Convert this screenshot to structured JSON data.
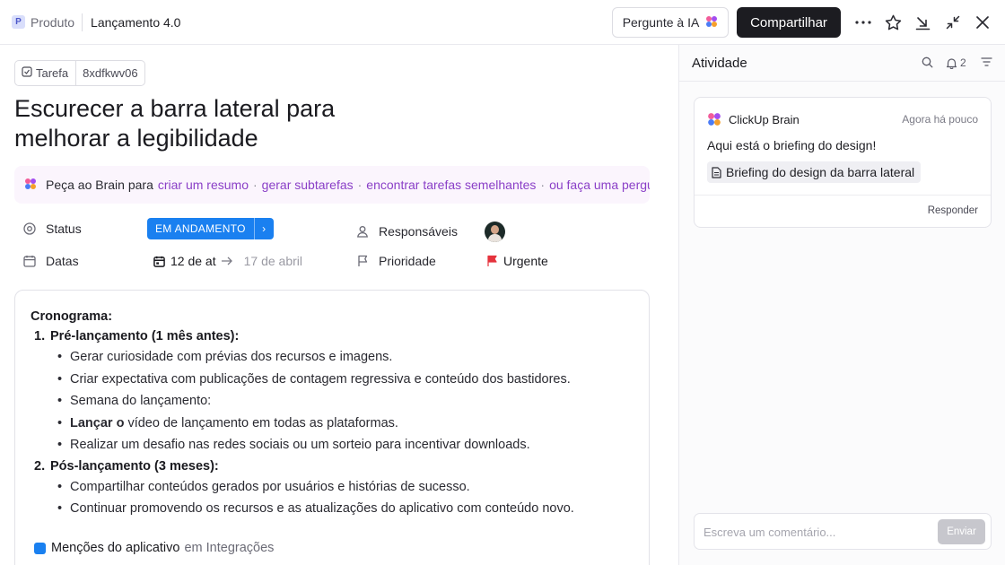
{
  "breadcrumb": {
    "space_badge": "P",
    "space_name": "Produto",
    "list_name": "Lançamento 4.0"
  },
  "toolbar": {
    "ask_ai_label": "Pergunte à IA",
    "share_label": "Compartilhar",
    "icons": [
      "more-icon",
      "star-icon",
      "minimize-to-tray-icon",
      "collapse-icon",
      "close-icon"
    ]
  },
  "task": {
    "type_label": "Tarefa",
    "id": "8xdfkwv06",
    "title": "Escurecer a barra lateral para melhorar a legibilidade"
  },
  "brain_bar": {
    "prefix": "Peça ao Brain para",
    "links": [
      "criar um resumo",
      "gerar subtarefas",
      "encontrar tarefas semelhantes",
      "ou faça uma pergunta"
    ],
    "separator": "·"
  },
  "fields": {
    "status_label": "Status",
    "status_value": "EM ANDAMENTO",
    "status_color": "#1a80f0",
    "dates_label": "Datas",
    "date_start": "12 de at",
    "date_end": "17 de abril",
    "assignees_label": "Responsáveis",
    "priority_label": "Prioridade",
    "priority_value": "Urgente",
    "priority_color": "#e5333d"
  },
  "description": {
    "heading": "Cronograma:",
    "sections": [
      {
        "num": "1.",
        "title": "Pré-lançamento (1 mês antes):",
        "items": [
          {
            "bold": "",
            "text": "Gerar curiosidade com prévias dos recursos e imagens."
          },
          {
            "bold": "",
            "text": "Criar expectativa com publicações de contagem regressiva e conteúdo dos bastidores."
          },
          {
            "bold": "",
            "text": "Semana do lançamento:"
          },
          {
            "bold": "Lançar o",
            "text": " vídeo de lançamento em todas as plataformas."
          },
          {
            "bold": "",
            "text": "Realizar um desafio nas redes sociais ou um sorteio para incentivar downloads."
          }
        ]
      },
      {
        "num": "2.",
        "title": "Pós-lançamento (3 meses):",
        "items": [
          {
            "bold": "",
            "text": "Compartilhar conteúdos gerados por usuários e histórias de sucesso."
          },
          {
            "bold": "",
            "text": "Continuar promovendo os recursos e as atualizações do aplicativo com conteúdo novo."
          }
        ]
      }
    ],
    "mention_name": "Menções do aplicativo",
    "mention_location": "em Integrações"
  },
  "activity": {
    "title": "Atividade",
    "notification_count": "2",
    "comment": {
      "author": "ClickUp Brain",
      "time": "Agora há pouco",
      "text": "Aqui está o briefing do design!",
      "doc_title": "Briefing do design da barra lateral",
      "reply_label": "Responder"
    },
    "input_placeholder": "Escreva um comentário...",
    "send_label": "Enviar"
  }
}
